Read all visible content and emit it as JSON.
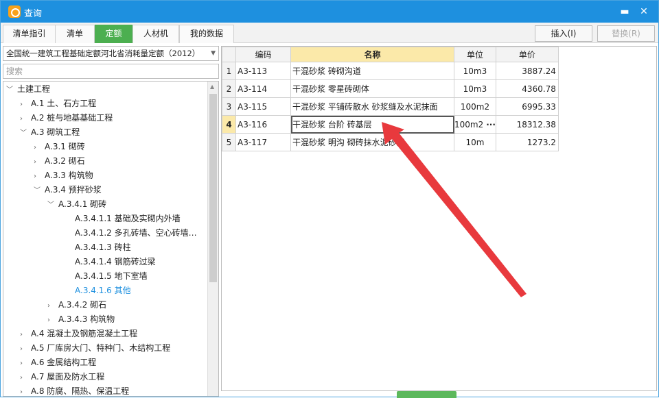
{
  "window": {
    "title": "查询",
    "minimize_glyph": "▬",
    "close_glyph": "✕"
  },
  "tabs": [
    {
      "label": "清单指引"
    },
    {
      "label": "清单"
    },
    {
      "label": "定额"
    },
    {
      "label": "人材机"
    },
    {
      "label": "我的数据"
    }
  ],
  "actions": {
    "insert": "插入(I)",
    "replace": "替换(R)"
  },
  "left": {
    "library": "全国统一建筑工程基础定额河北省消耗量定额（2012）",
    "search_placeholder": "搜索",
    "tree": [
      {
        "label": "土建工程"
      },
      {
        "label": "A.1 土、石方工程"
      },
      {
        "label": "A.2 桩与地基基础工程"
      },
      {
        "label": "A.3 砌筑工程"
      },
      {
        "label": "A.3.1 砌砖"
      },
      {
        "label": "A.3.2 砌石"
      },
      {
        "label": "A.3.3 构筑物"
      },
      {
        "label": "A.3.4 预拌砂浆"
      },
      {
        "label": "A.3.4.1 砌砖"
      },
      {
        "label": "A.3.4.1.1 基础及实砌内外墙"
      },
      {
        "label": "A.3.4.1.2 多孔砖墙、空心砖墙…"
      },
      {
        "label": "A.3.4.1.3 砖柱"
      },
      {
        "label": "A.3.4.1.4 钢筋砖过梁"
      },
      {
        "label": "A.3.4.1.5 地下室墙"
      },
      {
        "label": "A.3.4.1.6 其他"
      },
      {
        "label": "A.3.4.2 砌石"
      },
      {
        "label": "A.3.4.3 构筑物"
      },
      {
        "label": "A.4 混凝土及钢筋混凝土工程"
      },
      {
        "label": "A.5 厂库房大门、特种门、木结构工程"
      },
      {
        "label": "A.6 金属结构工程"
      },
      {
        "label": "A.7 屋面及防水工程"
      },
      {
        "label": "A.8 防腐、隔热、保温工程"
      }
    ]
  },
  "grid": {
    "columns": {
      "code": "编码",
      "name": "名称",
      "unit": "单位",
      "price": "单价"
    },
    "rows": [
      {
        "num": "1",
        "code": "A3-113",
        "name": "干混砂浆 砖砌沟道",
        "unit": "10m3",
        "price": "3887.24"
      },
      {
        "num": "2",
        "code": "A3-114",
        "name": "干混砂浆 零星砖砌体",
        "unit": "10m3",
        "price": "4360.78"
      },
      {
        "num": "3",
        "code": "A3-115",
        "name": "干混砂浆 平铺砖散水 砂浆缝及水泥抹面",
        "unit": "100m2",
        "price": "6995.33"
      },
      {
        "num": "4",
        "code": "A3-116",
        "name": "干混砂浆 台阶 砖基层",
        "unit": "100m2",
        "unit_more": "···",
        "price": "18312.38"
      },
      {
        "num": "5",
        "code": "A3-117",
        "name": "干混砂浆 明沟 砌砖抹水泥砂浆",
        "unit": "10m",
        "price": "1273.2"
      }
    ]
  },
  "colors": {
    "titlebar": "#1e90df",
    "active_tab": "#4caf50",
    "annotation_arrow": "#e8393d",
    "highlight": "#fbe9a9"
  }
}
